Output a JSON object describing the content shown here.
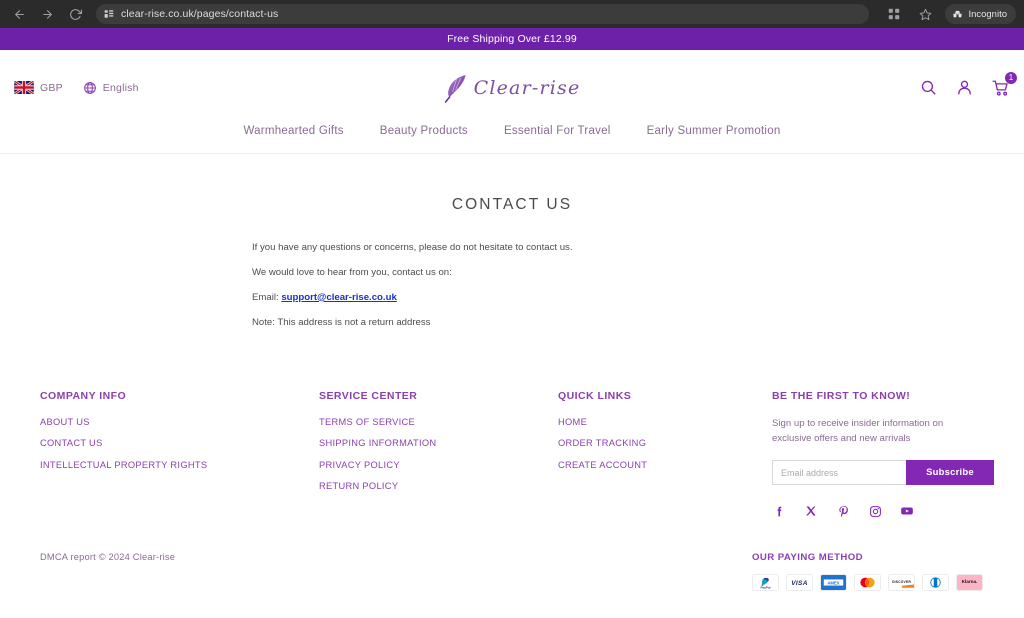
{
  "browser": {
    "url": "clear-rise.co.uk/pages/contact-us",
    "back_icon": "back-arrow-icon",
    "forward_icon": "forward-arrow-icon",
    "reload_icon": "reload-icon",
    "site_info_icon": "site-info-icon",
    "extensions_icon": "extensions-icon",
    "bookmark_icon": "star-icon",
    "incognito_label": "Incognito",
    "incognito_icon": "incognito-icon"
  },
  "announcement": {
    "text": "Free Shipping Over £12.99",
    "bg_color": "#6d21a8",
    "text_color": "#ffffff"
  },
  "header": {
    "currency": {
      "label": "GBP",
      "icon": "uk-flag-icon"
    },
    "language": {
      "label": "English",
      "icon": "globe-icon"
    },
    "brand": {
      "name": "Clear-rise",
      "icon": "feather-logo-icon",
      "color": "#7a4fa3"
    },
    "actions": {
      "search_icon": "search-icon",
      "account_icon": "user-account-icon",
      "cart_icon": "shopping-cart-icon",
      "cart_count": "1"
    }
  },
  "nav": {
    "items": [
      {
        "label": "Warmhearted Gifts"
      },
      {
        "label": "Beauty Products"
      },
      {
        "label": "Essential For Travel"
      },
      {
        "label": "Early Summer Promotion"
      }
    ]
  },
  "main": {
    "title": "CONTACT US",
    "paragraph1": "If you have any questions or concerns, please do not hesitate to contact us.",
    "paragraph2": "We would love to hear from you, contact us on:",
    "email_prefix": "Email: ",
    "email": "support@clear-rise.co.uk",
    "note": "Note: This address is not a return address"
  },
  "footer": {
    "company_info": {
      "title": "COMPANY INFO",
      "links": [
        {
          "label": "ABOUT US"
        },
        {
          "label": "CONTACT US"
        },
        {
          "label": "INTELLECTUAL PROPERTY RIGHTS"
        }
      ]
    },
    "service_center": {
      "title": "SERVICE CENTER",
      "links": [
        {
          "label": "TERMS OF SERVICE"
        },
        {
          "label": "SHIPPING INFORMATION"
        },
        {
          "label": "PRIVACY POLICY"
        },
        {
          "label": "RETURN POLICY"
        }
      ]
    },
    "quick_links": {
      "title": "QUICK LINKS",
      "links": [
        {
          "label": "HOME"
        },
        {
          "label": "ORDER TRACKING"
        },
        {
          "label": "CREATE ACCOUNT"
        }
      ]
    },
    "newsletter": {
      "title": "BE THE FIRST TO KNOW!",
      "copy": "Sign up to receive insider information on exclusive offers and new arrivals",
      "input_placeholder": "Email address",
      "input_value": "",
      "button_label": "Subscribe",
      "button_color": "#8327b5"
    },
    "social": [
      {
        "name": "facebook-icon"
      },
      {
        "name": "x-twitter-icon"
      },
      {
        "name": "pinterest-icon"
      },
      {
        "name": "instagram-icon"
      },
      {
        "name": "youtube-icon"
      }
    ]
  },
  "bottom": {
    "copyright": "DMCA report © 2024 Clear-rise",
    "payment_title": "OUR PAYING METHOD",
    "payment_methods": [
      {
        "name": "paypal-icon",
        "label": "PayPal"
      },
      {
        "name": "visa-icon",
        "label": "VISA"
      },
      {
        "name": "amex-icon",
        "label": "AMEX"
      },
      {
        "name": "mastercard-icon",
        "label": "Mastercard"
      },
      {
        "name": "discover-icon",
        "label": "DISCOVER"
      },
      {
        "name": "diners-club-icon",
        "label": "Diners Club"
      },
      {
        "name": "klarna-icon",
        "label": "Klarna"
      }
    ]
  }
}
